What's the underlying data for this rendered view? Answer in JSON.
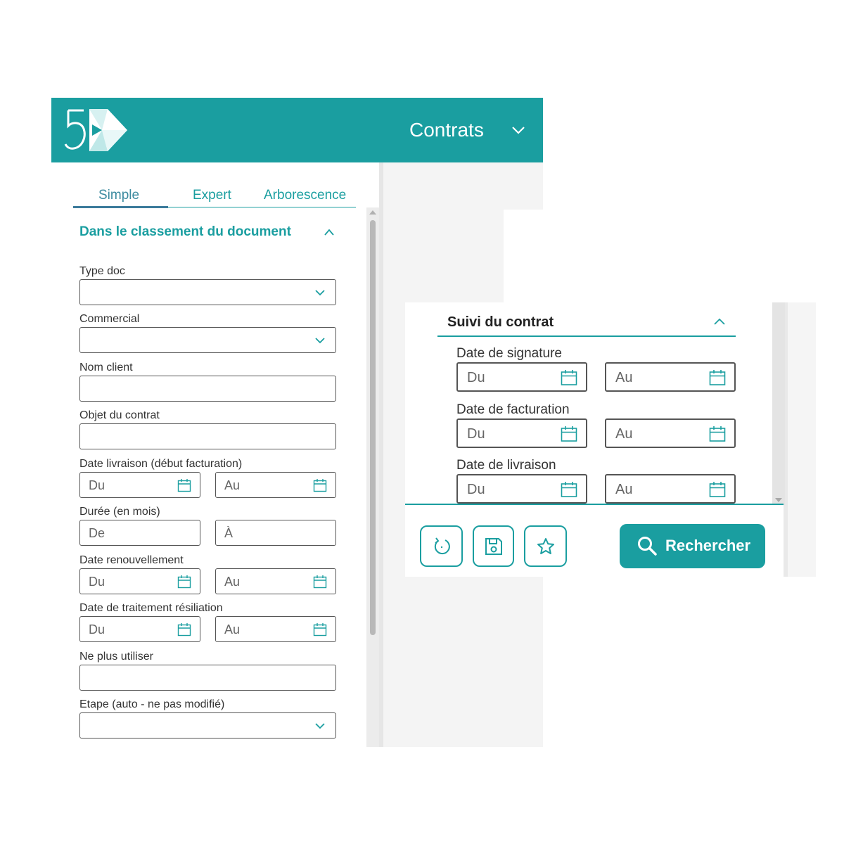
{
  "header": {
    "logo": "5D-logo",
    "title": "Contrats",
    "chevron_icon": "chevron-down-icon"
  },
  "tabs": [
    {
      "label": "Simple",
      "active": true
    },
    {
      "label": "Expert",
      "active": false
    },
    {
      "label": "Arborescence",
      "active": false
    }
  ],
  "section_left": {
    "title": "Dans le classement du document",
    "fields": {
      "type_doc": {
        "label": "Type doc"
      },
      "commercial": {
        "label": "Commercial"
      },
      "nom_client": {
        "label": "Nom client"
      },
      "objet_contrat": {
        "label": "Objet du contrat"
      },
      "date_livraison": {
        "label": "Date livraison (début facturation)",
        "from": "Du",
        "to": "Au"
      },
      "duree": {
        "label": "Durée (en mois)",
        "from": "De",
        "to": "À"
      },
      "date_renouvellement": {
        "label": "Date renouvellement",
        "from": "Du",
        "to": "Au"
      },
      "date_traitement_resiliation": {
        "label": "Date de traitement résiliation",
        "from": "Du",
        "to": "Au"
      },
      "ne_plus_utiliser": {
        "label": "Ne plus utiliser"
      },
      "etape": {
        "label": "Etape (auto - ne pas modifié)"
      }
    }
  },
  "section_right": {
    "title": "Suivi du contrat",
    "fields": {
      "date_signature": {
        "label": "Date de signature",
        "from": "Du",
        "to": "Au"
      },
      "date_facturation": {
        "label": "Date de facturation",
        "from": "Du",
        "to": "Au"
      },
      "date_livraison": {
        "label": "Date de livraison",
        "from": "Du",
        "to": "Au"
      }
    }
  },
  "actions": {
    "reset_icon": "reset-icon",
    "save_icon": "save-icon",
    "favorite_icon": "star-icon",
    "search_label": "Rechercher"
  },
  "colors": {
    "accent": "#1a9ea0",
    "tab_underline": "#3b7a9b",
    "border": "#555555"
  }
}
